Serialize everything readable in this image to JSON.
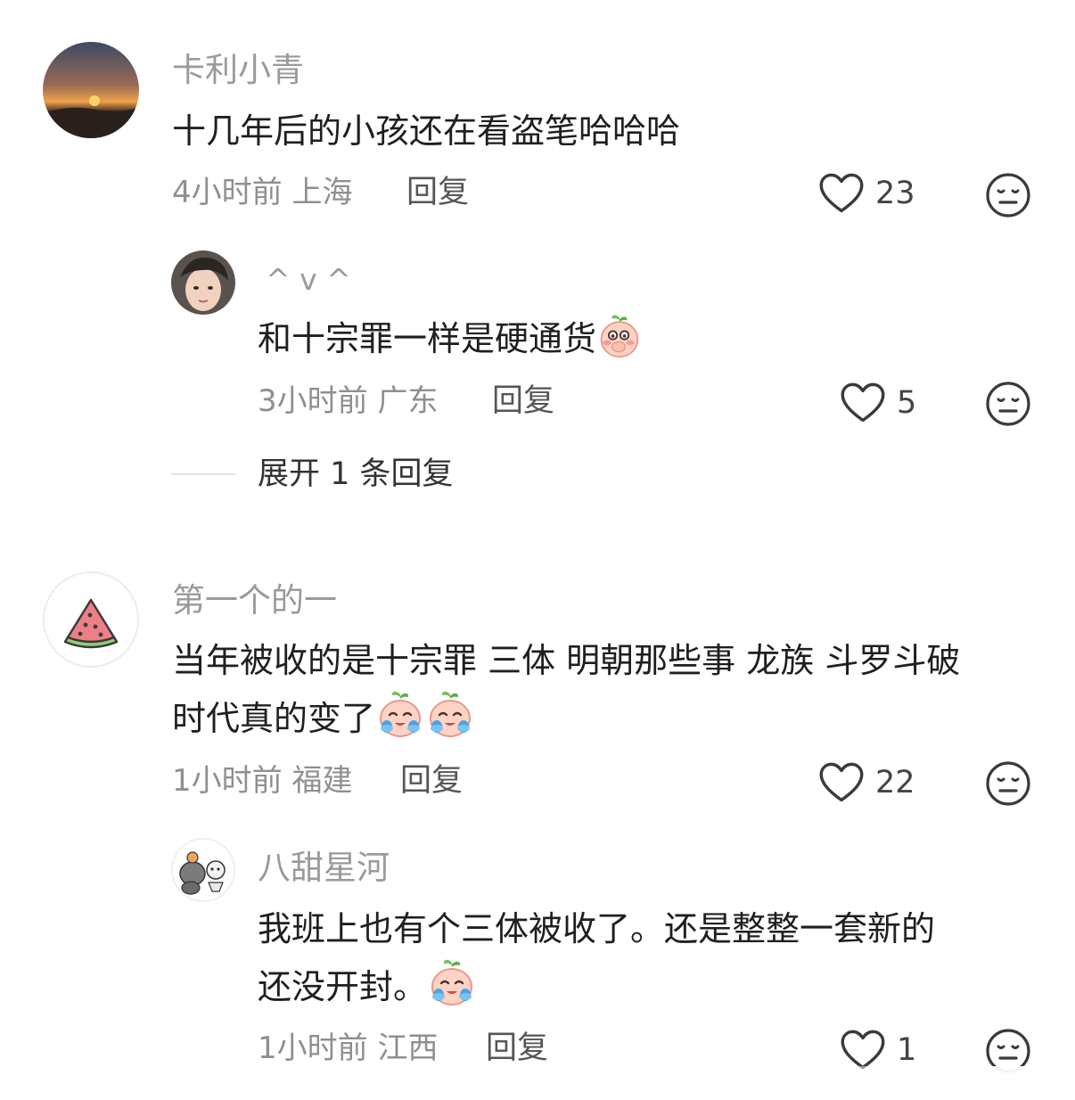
{
  "comments": [
    {
      "username": "卡利小青",
      "text_lines": [
        "十几年后的小孩还在看盗笔哈哈哈"
      ],
      "time": "4小时前",
      "location": "上海",
      "reply_label": "回复",
      "likes": "23",
      "replies": [
        {
          "username": "^ v ^",
          "text": "和十宗罪一样是硬通货",
          "time": "3小时前",
          "location": "广东",
          "reply_label": "回复",
          "likes": "5"
        }
      ],
      "expand_label": "展开 1 条回复"
    },
    {
      "username": "第一个的一",
      "text_lines": [
        "当年被收的是十宗罪 三体 明朝那些事 龙族 斗罗斗破",
        "时代真的变了"
      ],
      "time": "1小时前",
      "location": "福建",
      "reply_label": "回复",
      "likes": "22",
      "replies": [
        {
          "username": "八甜星河",
          "text_lines": [
            "我班上也有个三体被收了。还是整整一套新的",
            "还没开封。"
          ],
          "time": "1小时前",
          "location": "江西",
          "reply_label": "回复",
          "likes": "1"
        }
      ]
    }
  ],
  "colors": {
    "username": "#9a9a9a",
    "text": "#1f1f1f",
    "meta": "#8f8f8f",
    "icon": "#3a3a3a"
  },
  "icons": {
    "like": "heart-outline-icon",
    "dislike": "meh-face-icon",
    "emoji_shy": "shy-peach-emoji",
    "emoji_cry": "crying-peach-emoji"
  }
}
